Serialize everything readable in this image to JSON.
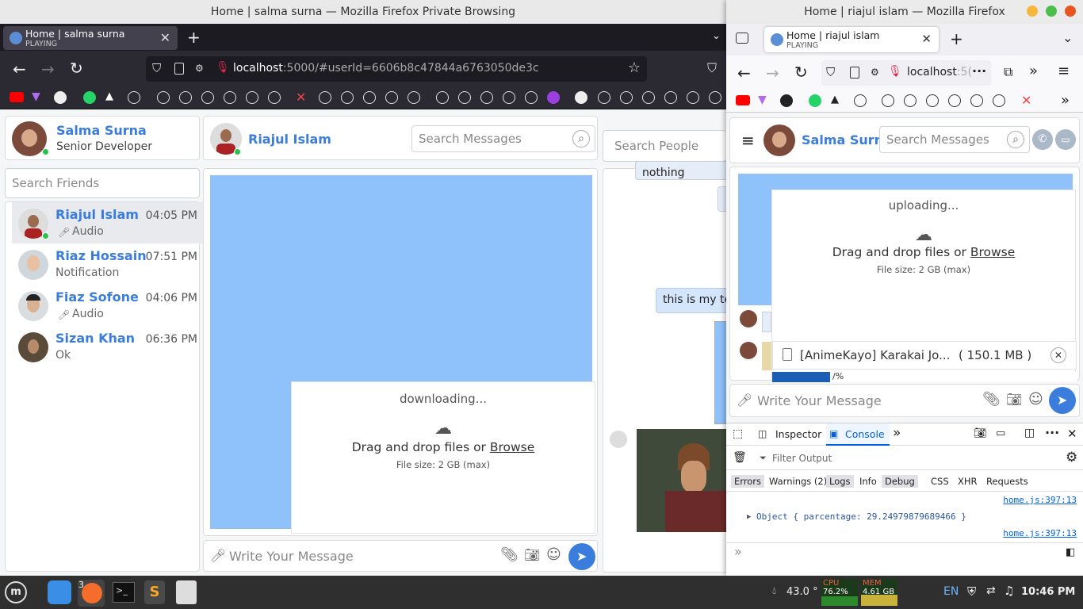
{
  "left_window": {
    "title": "Home | salma surna — Mozilla Firefox Private Browsing",
    "tab": {
      "label": "Home | salma surna",
      "sub": "PLAYING"
    },
    "url": {
      "host": "localhost",
      "rest": ":5000/#userId=6606b8c47844a6763050de3c"
    },
    "app": {
      "me": {
        "name": "Salma Surna",
        "role": "Senior Developer"
      },
      "friends_search_placeholder": "Search Friends",
      "friends": [
        {
          "name": "Riajul Islam",
          "time": "04:05 PM",
          "sub": "Audio"
        },
        {
          "name": "Riaz Hossain",
          "time": "07:51 PM",
          "sub": "Notification"
        },
        {
          "name": "Fiaz Sofone",
          "time": "04:06 PM",
          "sub": "Audio"
        },
        {
          "name": "Sizan Khan",
          "time": "06:36 PM",
          "sub": "Ok"
        }
      ],
      "chat_header_name": "Riajul Islam",
      "messages_search_placeholder": "Search Messages",
      "people_search_placeholder": "Search People",
      "download_box": {
        "status": "downloading...",
        "drop_text": "Drag and drop files or ",
        "browse": "Browse",
        "size_note": "File size: 2 GB (max)"
      },
      "bg_messages": [
        "nothing",
        "this is my te"
      ],
      "message_placeholder": "Write Your Message"
    }
  },
  "right_window": {
    "title": "Home | riajul islam — Mozilla Firefox",
    "tab": {
      "label": "Home | riajul islam",
      "sub": "PLAYING"
    },
    "url": {
      "host": "localhost",
      "rest": ":5("
    },
    "app": {
      "me_name": "Salma Surna",
      "messages_search_placeholder": "Search Messages",
      "upload_box": {
        "status": "uploading...",
        "drop_text": "Drag and drop files or ",
        "browse": "Browse",
        "size_note": "File size: 2 GB (max)"
      },
      "file": {
        "name": "[AnimeKayo] Karakai Jo...",
        "size": "( 150.1 MB )",
        "progress": 0.293,
        "progress_label": "/%"
      },
      "message_placeholder": "Write Your Message"
    },
    "devtools": {
      "tabs": [
        "Inspector",
        "Console"
      ],
      "filter_placeholder": "Filter Output",
      "filters": [
        "Errors",
        "Warnings (2)",
        "Logs",
        "Info",
        "Debug",
        "CSS",
        "XHR",
        "Requests"
      ],
      "log_source_1": "home.js:397:13",
      "log_object": "Object { parcentage: 29.24979879689466 }",
      "log_source_2": "home.js:397:13",
      "prompt": "»"
    }
  },
  "taskbar": {
    "firefox_badge": "3",
    "temperature": "43.0 °",
    "cpu_label": "CPU",
    "cpu_value": "76.2%",
    "mem_label": "MEM",
    "mem_value": "4.61 GB",
    "lang": "EN",
    "clock": "10:46 PM"
  },
  "colors": {
    "accent": "#3b7ddd",
    "image_placeholder": "#8fc1fb",
    "online": "#27c24c",
    "progress": "#1a5fb4"
  }
}
